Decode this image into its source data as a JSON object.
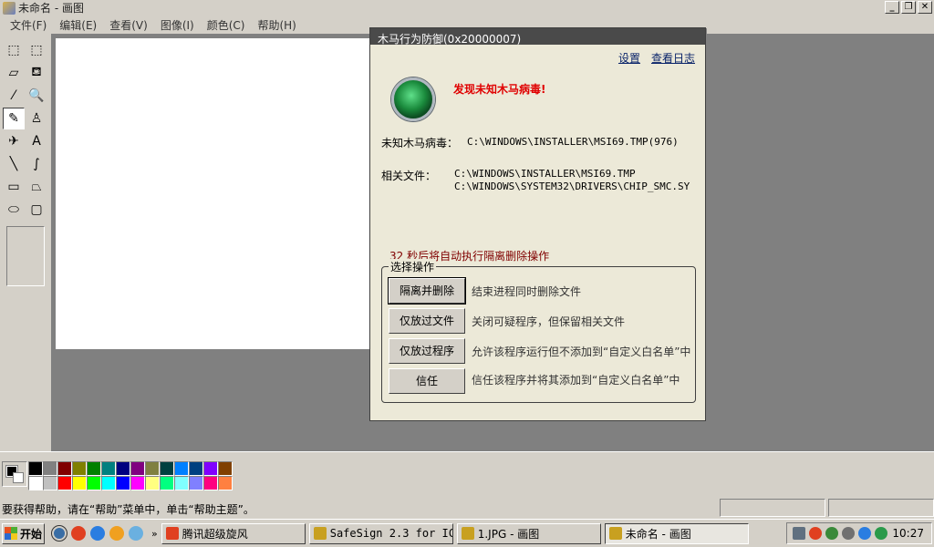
{
  "window": {
    "title": "未命名 - 画图"
  },
  "window_controls": {
    "minimize": "_",
    "restore": "❐",
    "close": "✕"
  },
  "menu": [
    "文件(F)",
    "编辑(E)",
    "查看(V)",
    "图像(I)",
    "颜色(C)",
    "帮助(H)"
  ],
  "tools": [
    {
      "name": "free-select-tool",
      "glyph": "⬚"
    },
    {
      "name": "rect-select-tool",
      "glyph": "⬚"
    },
    {
      "name": "eraser-tool",
      "glyph": "▱"
    },
    {
      "name": "fill-tool",
      "glyph": "⛾"
    },
    {
      "name": "color-picker-tool",
      "glyph": "⁄"
    },
    {
      "name": "magnifier-tool",
      "glyph": "🔍"
    },
    {
      "name": "pencil-tool",
      "glyph": "✎"
    },
    {
      "name": "brush-tool",
      "glyph": "♙"
    },
    {
      "name": "airbrush-tool",
      "glyph": "✈"
    },
    {
      "name": "text-tool",
      "glyph": "A"
    },
    {
      "name": "line-tool",
      "glyph": "╲"
    },
    {
      "name": "curve-tool",
      "glyph": "∫"
    },
    {
      "name": "rectangle-tool",
      "glyph": "▭"
    },
    {
      "name": "polygon-tool",
      "glyph": "⏢"
    },
    {
      "name": "ellipse-tool",
      "glyph": "⬭"
    },
    {
      "name": "rounded-rect-tool",
      "glyph": "▢"
    }
  ],
  "active_tool": "pencil-tool",
  "palette": {
    "row1": [
      "#000000",
      "#808080",
      "#800000",
      "#808000",
      "#008000",
      "#008080",
      "#000080",
      "#800080",
      "#808040",
      "#004040",
      "#0080ff",
      "#004080",
      "#8000ff",
      "#804000"
    ],
    "row2": [
      "#ffffff",
      "#c0c0c0",
      "#ff0000",
      "#ffff00",
      "#00ff00",
      "#00ffff",
      "#0000ff",
      "#ff00ff",
      "#ffff80",
      "#00ff80",
      "#80ffff",
      "#8080ff",
      "#ff0080",
      "#ff8040"
    ]
  },
  "statusbar": {
    "help_text": "要获得帮助，请在“帮助”菜单中，单击“帮助主题”。"
  },
  "dialog": {
    "title": "木马行为防御(0x20000007)",
    "links": {
      "settings": "设置",
      "view_log": "查看日志"
    },
    "alert": "发现未知木马病毒!",
    "virus_label": "未知木马病毒：",
    "virus_value": "C:\\WINDOWS\\INSTALLER\\MSI69.TMP(976)",
    "files_label": "相关文件：",
    "files": [
      "C:\\WINDOWS\\INSTALLER\\MSI69.TMP",
      "C:\\WINDOWS\\SYSTEM32\\DRIVERS\\CHIP_SMC.SY"
    ],
    "countdown": "32 秒后将自动执行隔离删除操作",
    "ops_legend": "选择操作",
    "operations": [
      {
        "label": "隔离并删除",
        "desc": "结束进程同时删除文件"
      },
      {
        "label": "仅放过文件",
        "desc": "关闭可疑程序，但保留相关文件"
      },
      {
        "label": "仅放过程序",
        "desc": "允许该程序运行但不添加到“自定义白名单”中"
      },
      {
        "label": "信任",
        "desc": "信任该程序并将其添加到“自定义白名单”中"
      }
    ]
  },
  "taskbar": {
    "start": "开始",
    "chevron": "»",
    "tasks": [
      {
        "label": "腾讯超级旋风",
        "icon_color": "#e04020"
      },
      {
        "label": "SafeSign 2.3 for IC...",
        "icon_color": "#c8a020"
      },
      {
        "label": "1.JPG - 画图",
        "icon_color": "#c8a020"
      },
      {
        "label": "未命名 - 画图",
        "icon_color": "#c8a020"
      }
    ],
    "clock": "10:27"
  }
}
